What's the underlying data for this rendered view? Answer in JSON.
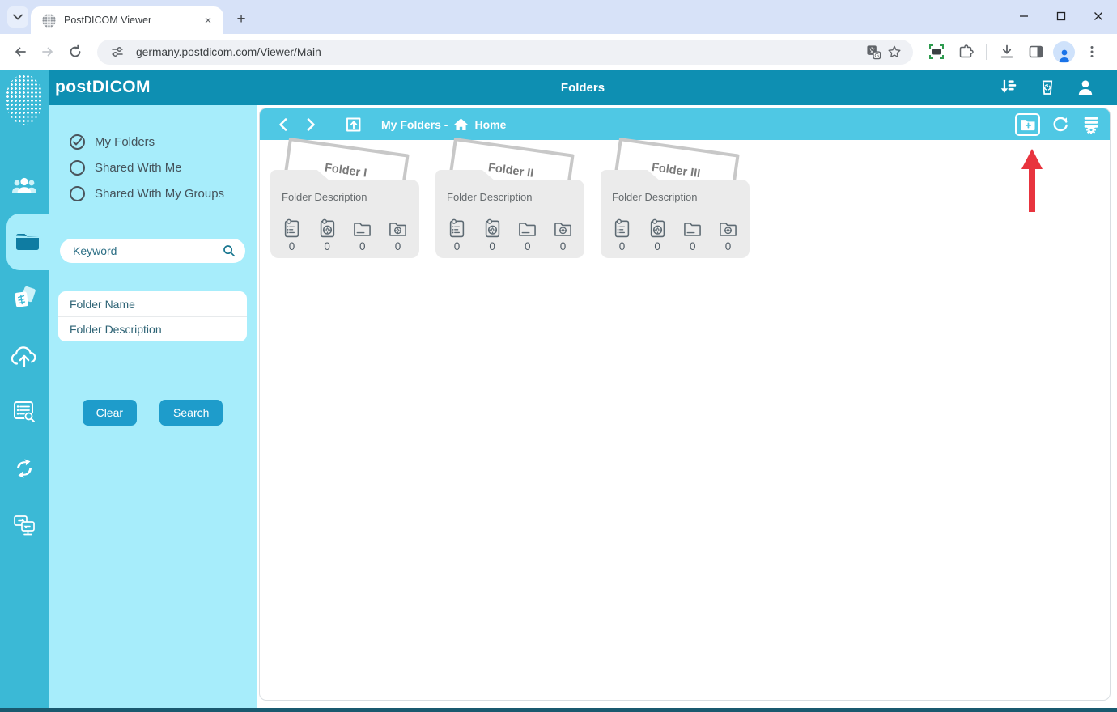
{
  "browser": {
    "tab_title": "PostDICOM Viewer",
    "new_tab_label": "+",
    "close_tab_label": "×",
    "url": "germany.postdicom.com/Viewer/Main",
    "window_controls": {
      "minimize": "minimize",
      "maximize": "maximize",
      "close": "close"
    },
    "toolbar_icons": [
      "back-arrow",
      "forward-arrow",
      "reload",
      "site-settings",
      "translate",
      "bookmark-star",
      "screenshot-extension",
      "extensions-puzzle",
      "download",
      "side-panel",
      "profile-avatar",
      "menu-kebab"
    ]
  },
  "app_header": {
    "logo": "postDICOM",
    "title": "Folders",
    "right_icons": [
      "download-queue",
      "recycle-bin",
      "account"
    ]
  },
  "rail": {
    "items": [
      {
        "name": "patients",
        "active": false
      },
      {
        "name": "folders",
        "active": true
      },
      {
        "name": "studies",
        "active": false
      },
      {
        "name": "cloud-upload",
        "active": false
      },
      {
        "name": "worklist-search",
        "active": false
      },
      {
        "name": "sync",
        "active": false
      },
      {
        "name": "remote-devices",
        "active": false
      }
    ]
  },
  "sidebar": {
    "options": [
      {
        "label": "My Folders",
        "selected": true
      },
      {
        "label": "Shared With Me",
        "selected": false
      },
      {
        "label": "Shared With My Groups",
        "selected": false
      }
    ],
    "keyword_placeholder": "Keyword",
    "folder_name_placeholder": "Folder Name",
    "folder_description_placeholder": "Folder Description",
    "clear_label": "Clear",
    "search_label": "Search"
  },
  "breadcrumb": {
    "path_label": "My Folders -",
    "home_label": "Home",
    "right_icons": [
      "add-folder",
      "refresh",
      "folder-process"
    ]
  },
  "folders": [
    {
      "name": "Folder I",
      "description": "Folder Description",
      "counts": [
        "0",
        "0",
        "0",
        "0"
      ]
    },
    {
      "name": "Folder II",
      "description": "Folder Description",
      "counts": [
        "0",
        "0",
        "0",
        "0"
      ]
    },
    {
      "name": "Folder III",
      "description": "Folder Description",
      "counts": [
        "0",
        "0",
        "0",
        "0"
      ]
    }
  ],
  "stat_icon_names": [
    "clipboard-orders",
    "clipboard-studies",
    "subfolders",
    "shared-folder-studies"
  ],
  "annotation": {
    "type": "red-arrow",
    "points_at": "add-folder"
  },
  "colors": {
    "header_teal": "#0E8FB2",
    "rail_teal": "#3BB9D6",
    "panel_cyan": "#A7EDFB",
    "crumb_bar": "#4FC8E4",
    "button_blue": "#1E9CCB",
    "bottom_strip": "#19596F",
    "arrow_red": "#E8343E",
    "card_gray": "#EBEBEB"
  }
}
